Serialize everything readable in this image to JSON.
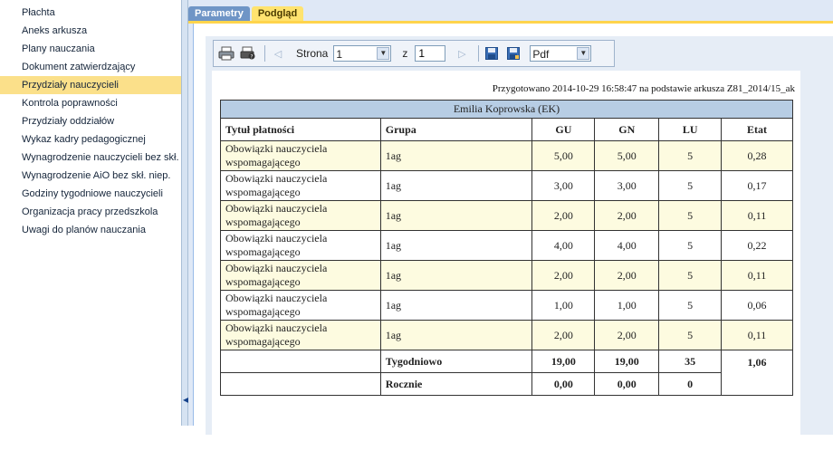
{
  "sidebar": {
    "items": [
      {
        "label": "Płachta",
        "active": false
      },
      {
        "label": "Aneks arkusza",
        "active": false
      },
      {
        "label": "Plany nauczania",
        "active": false
      },
      {
        "label": "Dokument zatwierdzający",
        "active": false
      },
      {
        "label": "Przydziały nauczycieli",
        "active": true
      },
      {
        "label": "Kontrola poprawności",
        "active": false
      },
      {
        "label": "Przydziały oddziałów",
        "active": false
      },
      {
        "label": "Wykaz kadry pedagogicznej",
        "active": false
      },
      {
        "label": "Wynagrodzenie nauczycieli bez skł. n",
        "active": false
      },
      {
        "label": "Wynagrodzenie AiO bez skł. niep.",
        "active": false
      },
      {
        "label": "Godziny tygodniowe nauczycieli",
        "active": false
      },
      {
        "label": "Organizacja pracy przedszkola",
        "active": false
      },
      {
        "label": "Uwagi do planów nauczania",
        "active": false
      }
    ]
  },
  "tabs": {
    "parametry": "Parametry",
    "podglad": "Podgląd"
  },
  "toolbar": {
    "page_label": "Strona",
    "page_value": "1",
    "of_label": "z",
    "of_value": "1",
    "format_value": "Pdf"
  },
  "report": {
    "prepared": "Przygotowano 2014-10-29 16:58:47 na podstawie arkusza Z81_2014/15_ak",
    "teacher": "Emilia Koprowska (EK)",
    "headers": {
      "title": "Tytuł płatności",
      "group": "Grupa",
      "gu": "GU",
      "gn": "GN",
      "lu": "LU",
      "etat": "Etat"
    },
    "rows": [
      {
        "title": "Obowiązki nauczyciela wspomagającego",
        "group": "1ag",
        "gu": "5,00",
        "gn": "5,00",
        "lu": "5",
        "etat": "0,28"
      },
      {
        "title": "Obowiązki nauczyciela wspomagającego",
        "group": "1ag",
        "gu": "3,00",
        "gn": "3,00",
        "lu": "5",
        "etat": "0,17"
      },
      {
        "title": "Obowiązki nauczyciela wspomagającego",
        "group": "1ag",
        "gu": "2,00",
        "gn": "2,00",
        "lu": "5",
        "etat": "0,11"
      },
      {
        "title": "Obowiązki nauczyciela wspomagającego",
        "group": "1ag",
        "gu": "4,00",
        "gn": "4,00",
        "lu": "5",
        "etat": "0,22"
      },
      {
        "title": "Obowiązki nauczyciela wspomagającego",
        "group": "1ag",
        "gu": "2,00",
        "gn": "2,00",
        "lu": "5",
        "etat": "0,11"
      },
      {
        "title": "Obowiązki nauczyciela wspomagającego",
        "group": "1ag",
        "gu": "1,00",
        "gn": "1,00",
        "lu": "5",
        "etat": "0,06"
      },
      {
        "title": "Obowiązki nauczyciela wspomagającego",
        "group": "1ag",
        "gu": "2,00",
        "gn": "2,00",
        "lu": "5",
        "etat": "0,11"
      }
    ],
    "weekly": {
      "label": "Tygodniowo",
      "gu": "19,00",
      "gn": "19,00",
      "lu": "35",
      "etat": "1,06"
    },
    "yearly": {
      "label": "Rocznie",
      "gu": "0,00",
      "gn": "0,00",
      "lu": "0"
    }
  }
}
